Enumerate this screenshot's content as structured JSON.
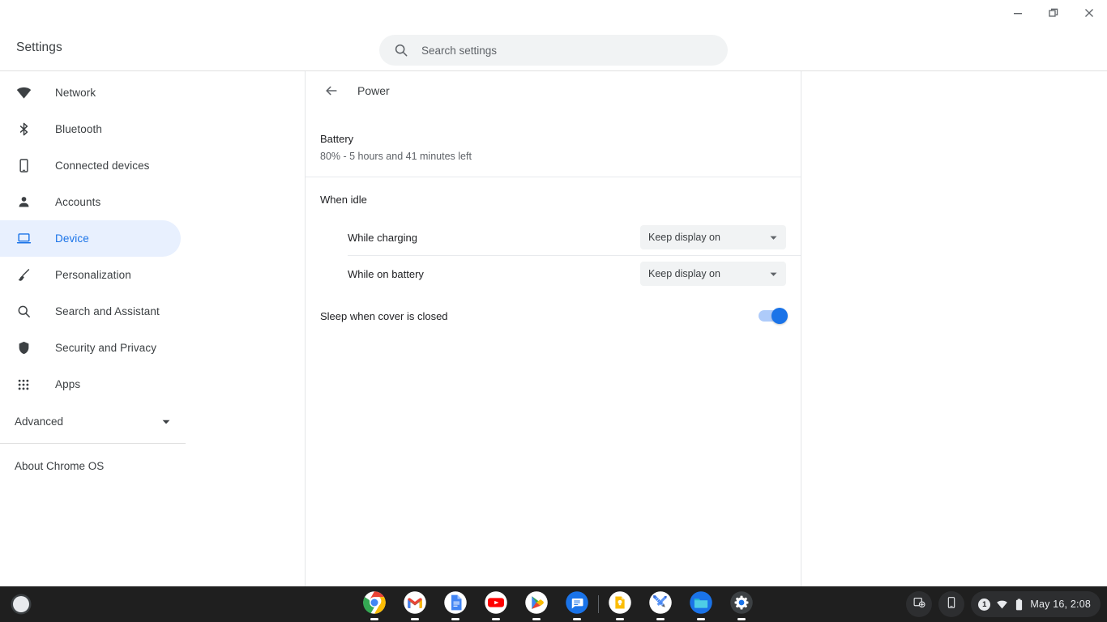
{
  "window": {
    "controls": [
      {
        "name": "minimize",
        "icon": "minimize-icon"
      },
      {
        "name": "restore",
        "icon": "restore-icon"
      },
      {
        "name": "close",
        "icon": "close-icon"
      }
    ]
  },
  "toolbar": {
    "title": "Settings",
    "search": {
      "icon": "search-icon",
      "placeholder": "Search settings",
      "value": ""
    }
  },
  "sidebar": {
    "items": [
      {
        "label": "Network",
        "icon": "wifi-icon",
        "selected": false
      },
      {
        "label": "Bluetooth",
        "icon": "bluetooth-icon",
        "selected": false
      },
      {
        "label": "Connected devices",
        "icon": "phone-icon",
        "selected": false
      },
      {
        "label": "Accounts",
        "icon": "person-icon",
        "selected": false
      },
      {
        "label": "Device",
        "icon": "laptop-icon",
        "selected": true
      },
      {
        "label": "Personalization",
        "icon": "brush-icon",
        "selected": false
      },
      {
        "label": "Search and Assistant",
        "icon": "magnifier-icon",
        "selected": false
      },
      {
        "label": "Security and Privacy",
        "icon": "shield-icon",
        "selected": false
      },
      {
        "label": "Apps",
        "icon": "grid-icon",
        "selected": false
      }
    ],
    "advanced": {
      "label": "Advanced",
      "icon": "chevron-down-icon"
    },
    "about": {
      "label": "About Chrome OS"
    }
  },
  "main": {
    "back_icon": "arrow-back-icon",
    "page_title": "Power",
    "battery": {
      "label": "Battery",
      "status": "80% - 5 hours and 41 minutes left",
      "percent": "80%",
      "time_left": "5 hours and 41 minutes left"
    },
    "when_idle": {
      "label": "When idle",
      "rows": [
        {
          "name": "While charging",
          "dropdown_value": "Keep display on",
          "dropdown_icon": "chevron-down-icon"
        },
        {
          "name": "While on battery",
          "dropdown_value": "Keep display on",
          "dropdown_icon": "chevron-down-icon"
        }
      ]
    },
    "sleep_cover": {
      "label": "Sleep when cover is closed",
      "toggle_on": true
    }
  },
  "shelf": {
    "launcher": {
      "name": "launcher-button",
      "icon": "launcher-icon"
    },
    "apps": [
      {
        "label": "Chrome",
        "icon": "chrome-icon",
        "running": true
      },
      {
        "label": "Gmail",
        "icon": "gmail-icon",
        "running": true
      },
      {
        "label": "Docs",
        "icon": "docs-icon",
        "running": true
      },
      {
        "label": "YouTube",
        "icon": "youtube-icon",
        "running": true
      },
      {
        "label": "Play Store",
        "icon": "play-store-icon",
        "running": true
      },
      {
        "label": "Messages",
        "icon": "messages-icon",
        "running": true
      },
      {
        "label": "Keep",
        "icon": "keep-icon",
        "running": true
      },
      {
        "label": "Canvas",
        "icon": "canvas-icon",
        "running": true
      },
      {
        "label": "Files",
        "icon": "files-icon",
        "running": true
      },
      {
        "label": "Settings",
        "icon": "settings-gear-icon",
        "running": true
      }
    ],
    "tray": {
      "desk_button": {
        "icon": "new-desk-icon"
      },
      "phone_hub_button": {
        "icon": "phone-hub-icon"
      },
      "status": {
        "notification_count": "1",
        "wifi_icon": "wifi-icon",
        "battery_icon": "battery-icon",
        "clock": "May 16, 2:08"
      }
    }
  },
  "colors": {
    "accent": "#1a73e8",
    "selected_bg": "#e8f0fe",
    "toolbar_bg": "#ffffff",
    "field_bg": "#f1f3f4",
    "shelf_bg": "#1f1f1f",
    "text_primary": "#202124",
    "text_secondary": "#5f6368"
  }
}
